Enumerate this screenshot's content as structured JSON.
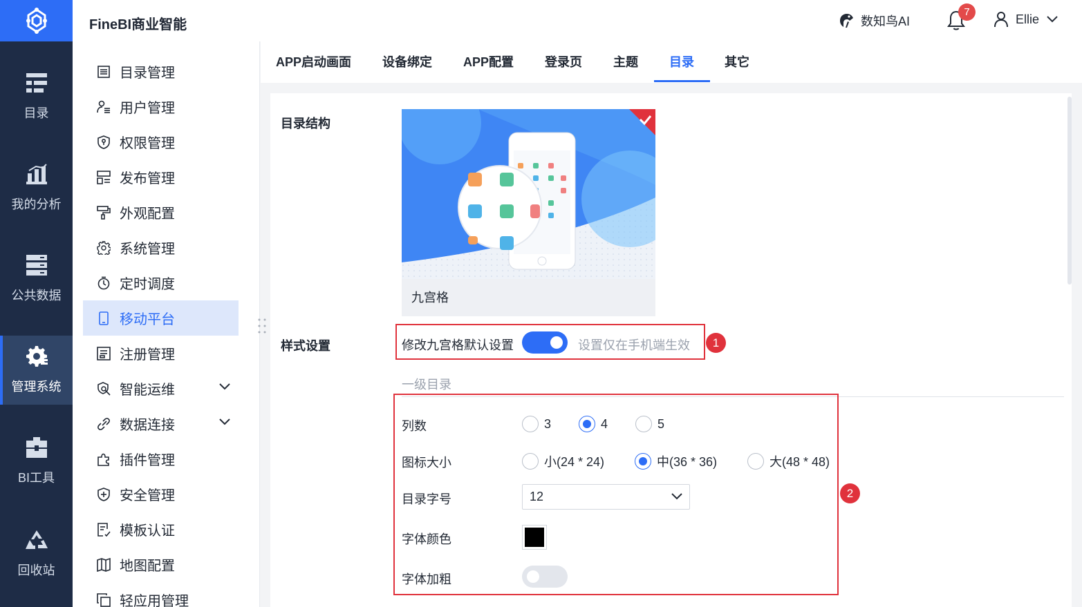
{
  "app": {
    "title": "FineBI商业智能",
    "colors": {
      "brand": "#2d6df6",
      "rail": "#1e2c46",
      "rail_active": "#304567",
      "callout": "#e0323c"
    }
  },
  "header": {
    "ai_label": "数知鸟AI",
    "notification_count": "7",
    "user_name": "Ellie"
  },
  "rail": {
    "items": [
      {
        "label": "目录",
        "icon": "catalog-icon"
      },
      {
        "label": "我的分析",
        "icon": "analysis-chart-icon"
      },
      {
        "label": "公共数据",
        "icon": "database-stack-icon"
      },
      {
        "label": "管理系统",
        "icon": "gear-icon",
        "active": true
      },
      {
        "label": "BI工具",
        "icon": "toolbox-icon"
      },
      {
        "label": "回收站",
        "icon": "recycle-icon"
      }
    ]
  },
  "submenu": {
    "items": [
      {
        "label": "目录管理",
        "icon": "list-icon"
      },
      {
        "label": "用户管理",
        "icon": "user-list-icon"
      },
      {
        "label": "权限管理",
        "icon": "shield-lock-icon"
      },
      {
        "label": "发布管理",
        "icon": "publish-icon"
      },
      {
        "label": "外观配置",
        "icon": "paint-roller-icon"
      },
      {
        "label": "系统管理",
        "icon": "gear-icon"
      },
      {
        "label": "定时调度",
        "icon": "stopwatch-icon"
      },
      {
        "label": "移动平台",
        "icon": "mobile-icon",
        "active": true
      },
      {
        "label": "注册管理",
        "icon": "register-icon"
      },
      {
        "label": "智能运维",
        "icon": "ops-search-icon",
        "expandable": true
      },
      {
        "label": "数据连接",
        "icon": "link-icon",
        "expandable": true
      },
      {
        "label": "插件管理",
        "icon": "puzzle-icon"
      },
      {
        "label": "安全管理",
        "icon": "shield-plus-icon"
      },
      {
        "label": "模板认证",
        "icon": "certificate-icon"
      },
      {
        "label": "地图配置",
        "icon": "map-icon"
      },
      {
        "label": "轻应用管理",
        "icon": "copy-icon"
      }
    ]
  },
  "tabs": [
    {
      "label": "APP启动画面"
    },
    {
      "label": "设备绑定"
    },
    {
      "label": "APP配置"
    },
    {
      "label": "登录页"
    },
    {
      "label": "主题"
    },
    {
      "label": "目录",
      "active": true
    },
    {
      "label": "其它"
    }
  ],
  "content": {
    "structure_label": "目录结构",
    "structure_option": "九宫格",
    "style_label": "样式设置",
    "modify_default_label": "修改九宫格默认设置",
    "modify_default_on": true,
    "modify_hint": "设置仅在手机端生效",
    "callout_1": "1",
    "callout_2": "2",
    "level1_title": "一级目录",
    "columns": {
      "label": "列数",
      "options": [
        "3",
        "4",
        "5"
      ],
      "selected": "4"
    },
    "icon_size": {
      "label": "图标大小",
      "options": [
        "小(24 * 24)",
        "中(36 * 36)",
        "大(48 * 48)"
      ],
      "selected": "中(36 * 36)"
    },
    "font_size": {
      "label": "目录字号",
      "value": "12"
    },
    "font_color": {
      "label": "字体颜色",
      "value": "#000000"
    },
    "font_bold": {
      "label": "字体加粗",
      "on": false
    }
  }
}
